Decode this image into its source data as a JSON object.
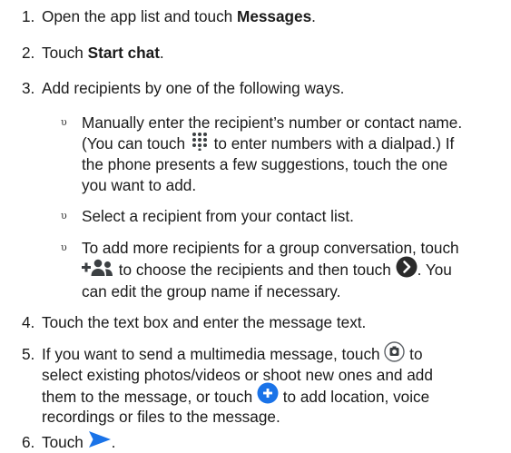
{
  "steps": [
    {
      "num": "1.",
      "pre": "Open the app list and touch ",
      "bold": "Messages",
      "post": "."
    },
    {
      "num": "2.",
      "pre": "Touch ",
      "bold": "Start chat",
      "post": "."
    },
    {
      "num": "3.",
      "text": "Add recipients by one of the following ways."
    },
    {
      "num": "4.",
      "text": "Touch the text box and enter the message text."
    },
    {
      "num": "5.",
      "line1_pre": "If you want to send a multimedia message, touch",
      "line1_post": "to",
      "line2": "select existing photos/videos or shoot new ones and add",
      "line3_pre": "them to the message, or touch",
      "line3_post": "to add location, voice",
      "line4": "recordings or files to the message."
    },
    {
      "num": "6.",
      "pre": "Touch",
      "post": "."
    }
  ],
  "bullets": {
    "marker": "υ",
    "b1": {
      "line1": "Manually enter the recipient’s number or contact name.",
      "line2_pre": "(You can touch",
      "line2_post": "to enter numbers with a dialpad.) If",
      "line3": "the phone presents a few suggestions, touch the one",
      "line4": "you want to add."
    },
    "b2": {
      "line1": "Select a recipient from your contact list."
    },
    "b3": {
      "line1": "To add more recipients for a group conversation, touch",
      "line2_mid": "to choose the recipients and then touch",
      "line2_post": ". You",
      "line3": "can edit the group name if necessary."
    }
  },
  "icons": {
    "dialpad": "dialpad-icon",
    "add_group": "add-group-icon",
    "next": "next-arrow-icon",
    "attach_media": "attach-media-icon",
    "add_more": "add-attachment-icon",
    "send": "send-icon"
  },
  "colors": {
    "text": "#1a1a1a",
    "accent_blue": "#1a73e8",
    "icon_dark": "#3c4043"
  }
}
